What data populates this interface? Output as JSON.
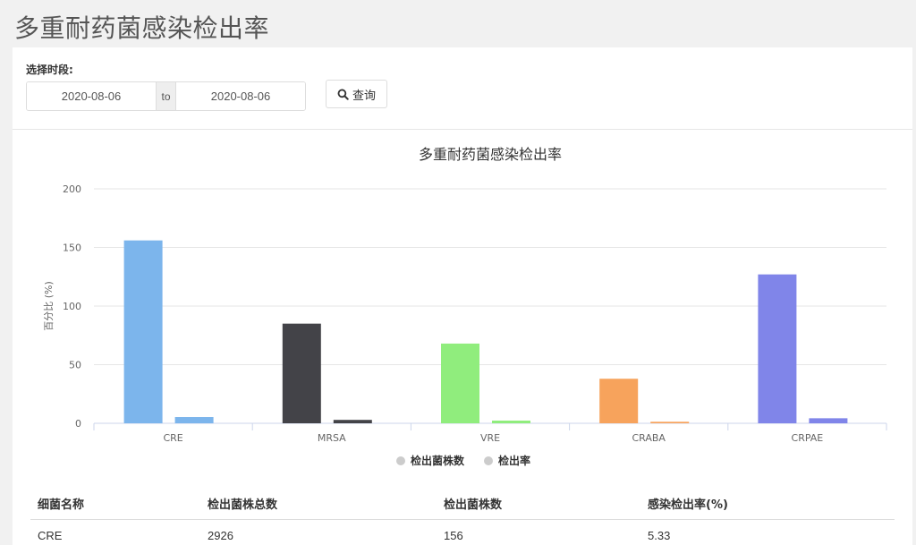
{
  "page": {
    "title": "多重耐药菌感染检出率"
  },
  "filter": {
    "label": "选择时段:",
    "start_date": "2020-08-06",
    "separator": "to",
    "end_date": "2020-08-06",
    "query_label": "查询"
  },
  "chart_data": {
    "type": "bar",
    "title": "多重耐药菌感染检出率",
    "ylabel": "百分比 (%)",
    "xlabel": "",
    "ylim": [
      0,
      200
    ],
    "yticks": [
      0,
      50,
      100,
      150,
      200
    ],
    "categories": [
      "CRE",
      "MRSA",
      "VRE",
      "CRABA",
      "CRPAE"
    ],
    "category_colors": [
      "#7cb5ec",
      "#434348",
      "#90ed7d",
      "#f7a35c",
      "#8085e9"
    ],
    "series": [
      {
        "name": "检出菌株数",
        "values": [
          156,
          85,
          68,
          38,
          127
        ]
      },
      {
        "name": "检出率",
        "values": [
          5.33,
          2.9,
          2.3,
          1.3,
          4.3
        ]
      }
    ],
    "legend": "bottom-center",
    "legend_color": "#cccccc",
    "grid": true
  },
  "table": {
    "headers": [
      "细菌名称",
      "检出菌株总数",
      "检出菌株数",
      "感染检出率(%)"
    ],
    "rows": [
      [
        "CRE",
        "2926",
        "156",
        "5.33"
      ]
    ]
  }
}
